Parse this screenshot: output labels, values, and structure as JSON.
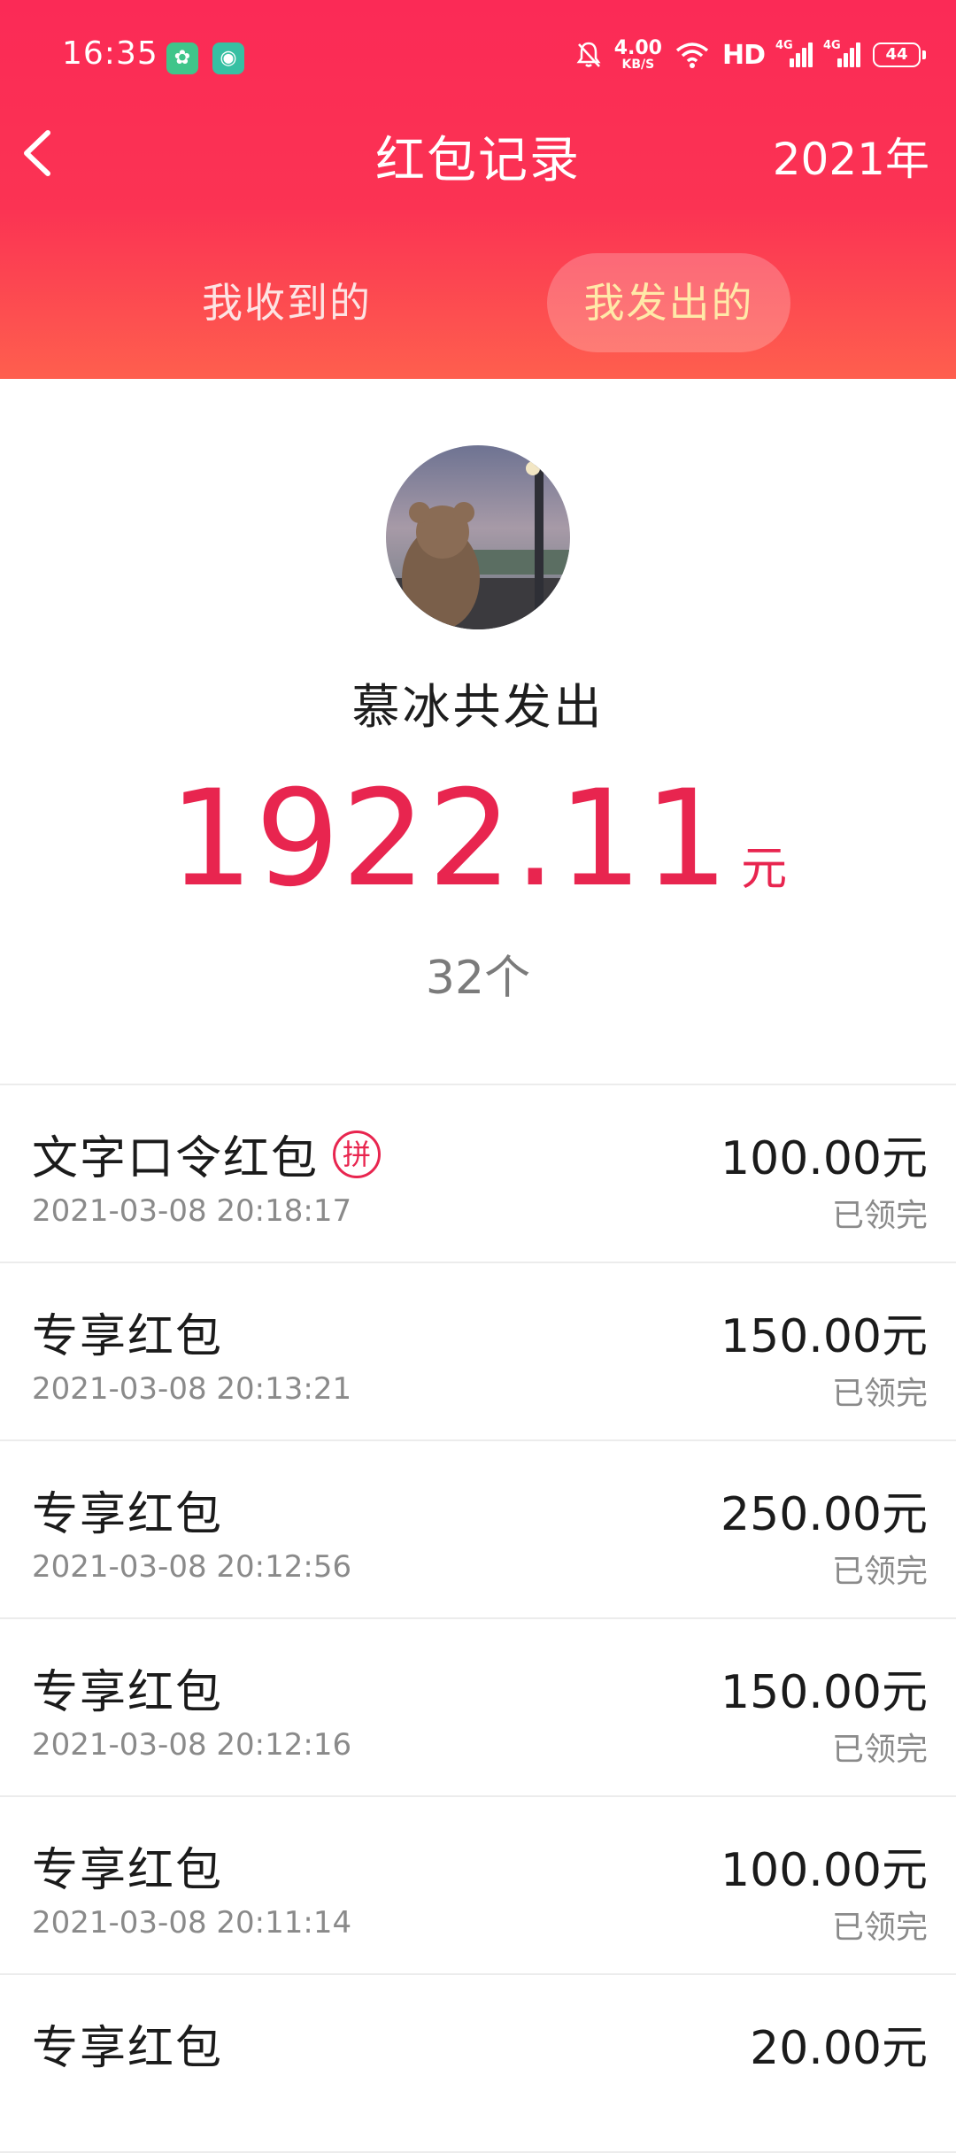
{
  "status_bar": {
    "time": "16:35",
    "app_badges": [
      "app-notification-icon",
      "chat-notification-icon"
    ],
    "net_speed_value": "4.00",
    "net_speed_unit": "KB/S",
    "hd_label": "HD",
    "sim1_label": "4G",
    "sim2_label": "4G",
    "battery": "44"
  },
  "nav": {
    "title": "红包记录",
    "year": "2021年"
  },
  "tabs": {
    "received": "我收到的",
    "sent": "我发出的",
    "active": "sent"
  },
  "summary": {
    "name": "慕冰共发出",
    "amount": "1922.11",
    "unit": "元",
    "count": "32个"
  },
  "records": [
    {
      "type": "文字口令红包",
      "badge": "拼",
      "time": "2021-03-08 20:18:17",
      "amount": "100.00元",
      "status": "已领完"
    },
    {
      "type": "专享红包",
      "time": "2021-03-08 20:13:21",
      "amount": "150.00元",
      "status": "已领完"
    },
    {
      "type": "专享红包",
      "time": "2021-03-08 20:12:56",
      "amount": "250.00元",
      "status": "已领完"
    },
    {
      "type": "专享红包",
      "time": "2021-03-08 20:12:16",
      "amount": "150.00元",
      "status": "已领完"
    },
    {
      "type": "专享红包",
      "time": "2021-03-08 20:11:14",
      "amount": "100.00元",
      "status": "已领完"
    },
    {
      "type": "专享红包",
      "time": "",
      "amount": "20.00元",
      "status": ""
    }
  ],
  "colors": {
    "header_top": "#fb2a56",
    "header_bottom": "#fe5f4e",
    "accent_red": "#e8254f",
    "active_tab_text": "#ffe9a8"
  }
}
